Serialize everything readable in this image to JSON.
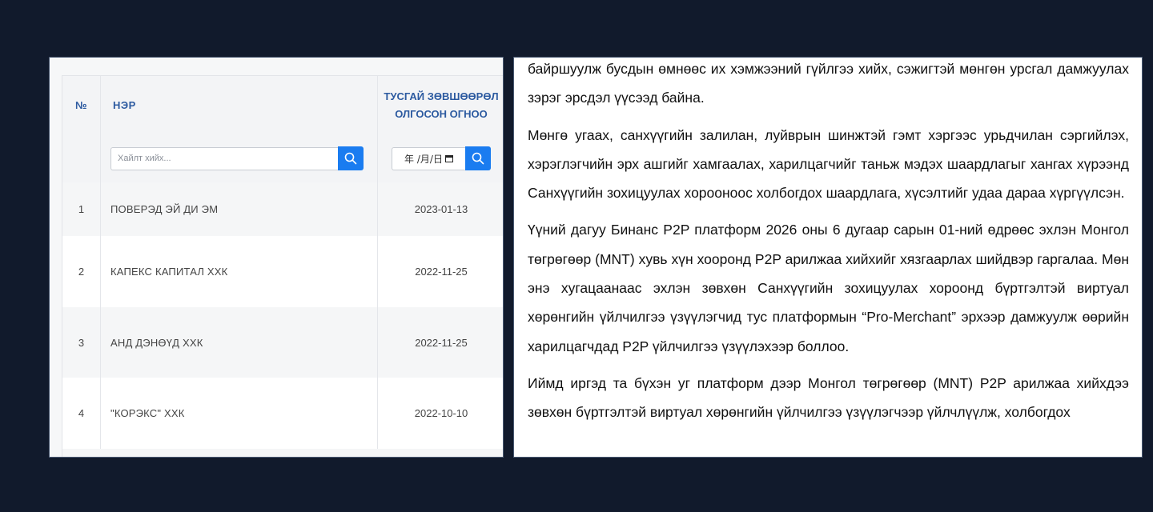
{
  "table": {
    "headers": {
      "number": "№",
      "name": "НЭР",
      "date_line1": "ТУСГАЙ ЗӨВШӨӨРӨЛ",
      "date_line2": "ОЛГОСОН ОГНОО"
    },
    "search": {
      "placeholder": "Хайлт хийх..."
    },
    "date_filter": {
      "display": "年 /月/日"
    },
    "icons": {
      "search": "search-icon",
      "calendar": "calendar-icon"
    },
    "rows": [
      {
        "no": "1",
        "name": "ПОВЕРЭД ЭЙ ДИ ЭМ",
        "date": "2023-01-13"
      },
      {
        "no": "2",
        "name": "КАПЕКС КАПИТАЛ ХХК",
        "date": "2022-11-25"
      },
      {
        "no": "3",
        "name": "АНД ДЭНӨҮД ХХК",
        "date": "2022-11-25"
      },
      {
        "no": "4",
        "name": "\"КОРЭКС\" ХХК",
        "date": "2022-10-10"
      }
    ]
  },
  "article": {
    "paragraphs": [
      "байршуулж бусдын өмнөөс их хэмжээний гүйлгээ хийх, сэжигтэй мөнгөн урсгал дамжуулах зэрэг эрсдэл үүсээд байна.",
      "Мөнгө угаах, санхүүгийн залилан, луйврын шинжтэй гэмт хэргээс урьдчилан сэргийлэх, хэрэглэгчийн эрх ашгийг хамгаалах, харилцагчийг таньж мэдэх шаардлагыг хангах хүрээнд Санхүүгийн зохицуулах хорооноос холбогдох шаардлага, хүсэлтийг удаа дараа хүргүүлсэн.",
      "Үүний дагуу Бинанс P2P платформ 2026 оны 6 дугаар сарын 01-ний өдрөөс эхлэн Монгол төгрөгөөр (MNT) хувь хүн хооронд P2P арилжаа хийхийг хязгаарлах шийдвэр гаргалаа. Мөн энэ хугацаанаас эхлэн зөвхөн Санхүүгийн зохицуулах хороонд бүртгэлтэй виртуал хөрөнгийн үйлчилгээ үзүүлэгчид тус платформын “Pro-Merchant” эрхээр дамжуулж өөрийн харилцагчдад P2P үйлчилгээ үзүүлэхээр боллоо.",
      "Иймд иргэд та бүхэн уг платформ дээр Монгол төгрөгөөр (MNT) P2P арилжаа хийхдээ зөвхөн бүртгэлтэй виртуал хөрөнгийн үйлчилгээ үзүүлэгчээр үйлчлүүлж, холбогдох"
    ]
  },
  "colors": {
    "background": "#111a2c",
    "header_text": "#2c5aa0",
    "button": "#1a7cf0"
  }
}
